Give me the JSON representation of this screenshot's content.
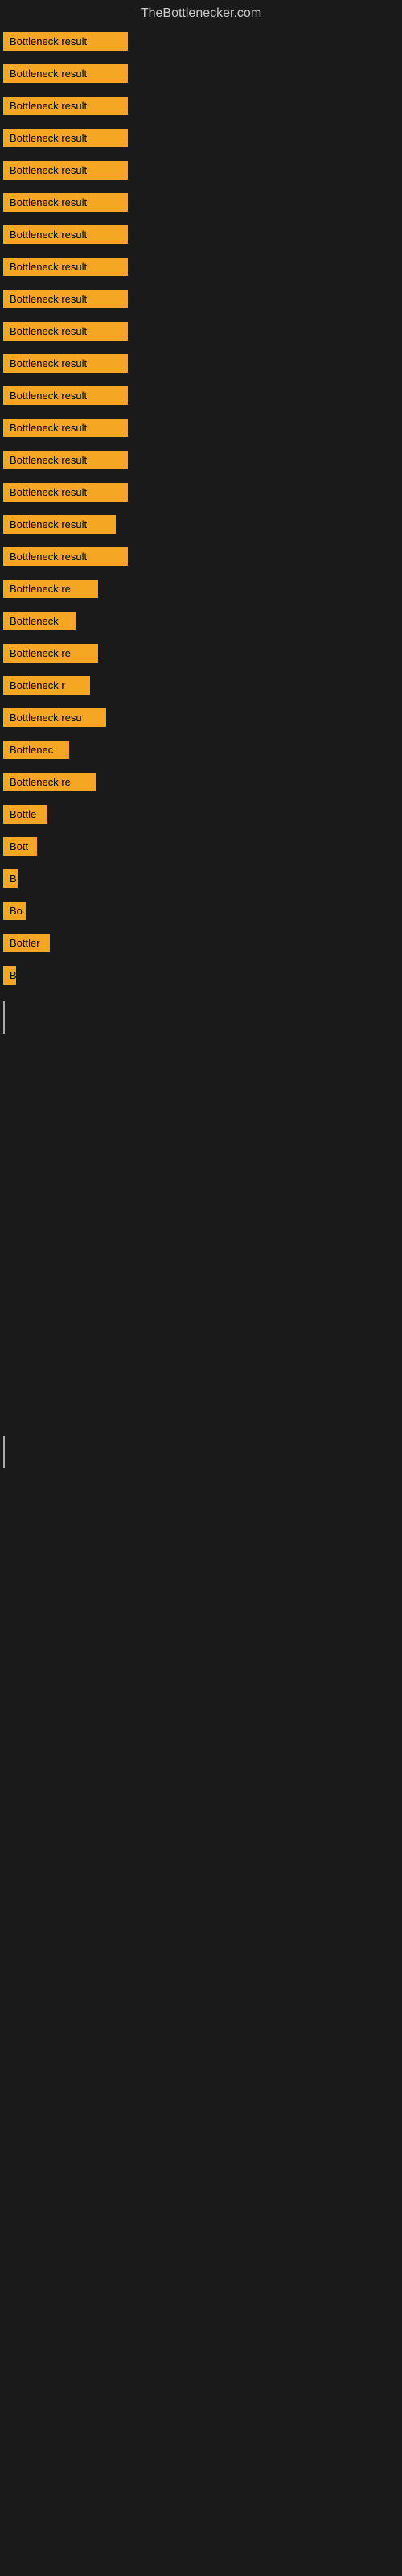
{
  "site": {
    "title": "TheBottlenecker.com"
  },
  "bars": [
    {
      "label": "Bottleneck result",
      "width": 155
    },
    {
      "label": "Bottleneck result",
      "width": 155
    },
    {
      "label": "Bottleneck result",
      "width": 155
    },
    {
      "label": "Bottleneck result",
      "width": 155
    },
    {
      "label": "Bottleneck result",
      "width": 155
    },
    {
      "label": "Bottleneck result",
      "width": 155
    },
    {
      "label": "Bottleneck result",
      "width": 155
    },
    {
      "label": "Bottleneck result",
      "width": 155
    },
    {
      "label": "Bottleneck result",
      "width": 155
    },
    {
      "label": "Bottleneck result",
      "width": 155
    },
    {
      "label": "Bottleneck result",
      "width": 155
    },
    {
      "label": "Bottleneck result",
      "width": 155
    },
    {
      "label": "Bottleneck result",
      "width": 155
    },
    {
      "label": "Bottleneck result",
      "width": 155
    },
    {
      "label": "Bottleneck result",
      "width": 155
    },
    {
      "label": "Bottleneck result",
      "width": 140
    },
    {
      "label": "Bottleneck result",
      "width": 155
    },
    {
      "label": "Bottleneck re",
      "width": 118
    },
    {
      "label": "Bottleneck",
      "width": 90
    },
    {
      "label": "Bottleneck re",
      "width": 118
    },
    {
      "label": "Bottleneck r",
      "width": 108
    },
    {
      "label": "Bottleneck resu",
      "width": 128
    },
    {
      "label": "Bottlenec",
      "width": 82
    },
    {
      "label": "Bottleneck re",
      "width": 115
    },
    {
      "label": "Bottle",
      "width": 55
    },
    {
      "label": "Bott",
      "width": 42
    },
    {
      "label": "B",
      "width": 18
    },
    {
      "label": "Bo",
      "width": 28
    },
    {
      "label": "Bottler",
      "width": 58
    },
    {
      "label": "B",
      "width": 16
    }
  ]
}
